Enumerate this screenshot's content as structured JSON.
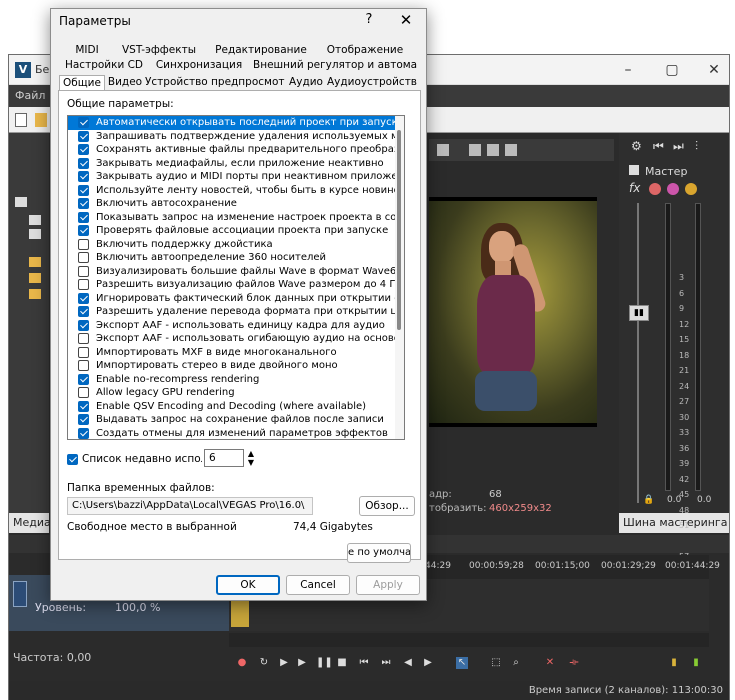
{
  "vegas": {
    "title": "Без",
    "menu_file": "Файл",
    "preview_info": {
      "label1": "адр:",
      "value1": "68",
      "label2": "тобразить:",
      "value2": "460x259x32"
    },
    "mixer": {
      "master_label": "Мастер",
      "footer": "Шина мастеринга",
      "db_labels": [
        "3",
        "6",
        "9",
        "12",
        "15",
        "18",
        "21",
        "24",
        "27",
        "30",
        "33",
        "36",
        "39",
        "42",
        "45",
        "48",
        "51",
        "54",
        "57"
      ],
      "bottom_labels": [
        "0.0",
        "0.0"
      ]
    },
    "left_footer": "Медиаф",
    "ruler_labels": [
      "44:29",
      "00:00:59;28",
      "00:01:15;00",
      "00:01:29;29",
      "00:01:44:29"
    ],
    "track": {
      "level_label": "Уровень:",
      "level_value": "100,0 %"
    },
    "freq_label": "Частота: 0,00",
    "status": "Время записи (2 каналов): 113:00:30"
  },
  "dialog": {
    "title": "Параметры",
    "help": "?",
    "close": "✕",
    "tabs_row1": [
      "MIDI",
      "VST-эффекты",
      "Редактирование",
      "Отображение"
    ],
    "tabs_row2": [
      "Настройки CD",
      "Синхронизация",
      "Внешний регулятор и автоматизац"
    ],
    "tabs_row3": [
      "Общие",
      "Видео",
      "Устройство предпросмотра",
      "Аудио",
      "Аудиоустройство"
    ],
    "general_label": "Общие параметры:",
    "options": [
      {
        "label": "Автоматически открывать последний проект при запуске",
        "checked": true,
        "selected": true
      },
      {
        "label": "Запрашивать подтверждение удаления используемых медиафайло",
        "checked": true
      },
      {
        "label": "Сохранять активные файлы предварительного преобразования пр",
        "checked": true
      },
      {
        "label": "Закрывать медиафайлы, если приложение неактивно",
        "checked": true
      },
      {
        "label": "Закрывать аудио и MIDI порты при неактивном приложении",
        "checked": true
      },
      {
        "label": "Используйте ленту новостей, чтобы быть в курсе новинок VEGAS",
        "checked": true
      },
      {
        "label": "Включить автосохранение",
        "checked": true
      },
      {
        "label": "Показывать запрос на изменение настроек проекта в соответстви",
        "checked": true
      },
      {
        "label": "Проверять файловые ассоциации проекта при запуске",
        "checked": true
      },
      {
        "label": "Включить поддержку джойстика",
        "checked": false
      },
      {
        "label": "Включить автоопределение 360 носителей",
        "checked": false
      },
      {
        "label": "Визуализировать большие файлы Wave в формат Wave64",
        "checked": false
      },
      {
        "label": "Разрешить визуализацию файлов Wave размером до 4 Гб",
        "checked": false
      },
      {
        "label": "Игнорировать фактический блок данных при открытии сжатых фа",
        "checked": true
      },
      {
        "label": "Разрешить удаление перевода формата при открытии цифрового в",
        "checked": true
      },
      {
        "label": "Экспорт AAF - использовать единицу кадра для аудио",
        "checked": true
      },
      {
        "label": "Экспорт AAF - использовать огибающую аудио на основе клипов",
        "checked": false
      },
      {
        "label": "Импортировать MXF в виде многоканального",
        "checked": false
      },
      {
        "label": "Импортировать стерео в виде двойного моно",
        "checked": false
      },
      {
        "label": "Enable no-recompress rendering",
        "checked": true
      },
      {
        "label": "Allow legacy GPU rendering",
        "checked": false
      },
      {
        "label": "Enable QSV Encoding and Decoding (where available)",
        "checked": true
      },
      {
        "label": "Выдавать запрос на сохранение файлов после записи",
        "checked": true
      },
      {
        "label": "Создать отмены для изменений параметров эффектов",
        "checked": true
      }
    ],
    "recent_label": "Список недавно использо",
    "recent_value": "6",
    "temp_folder_label": "Папка временных файлов:",
    "temp_folder_path": "C:\\Users\\bazzi\\AppData\\Local\\VEGAS Pro\\16.0\\",
    "browse_button": "Обзор...",
    "free_space_label": "Свободное место в выбранной",
    "free_space_value": "74,4 Gigabytes",
    "defaults_button": "е по умолчан",
    "ok_button": "OK",
    "cancel_button": "Cancel",
    "apply_button": "Apply"
  }
}
